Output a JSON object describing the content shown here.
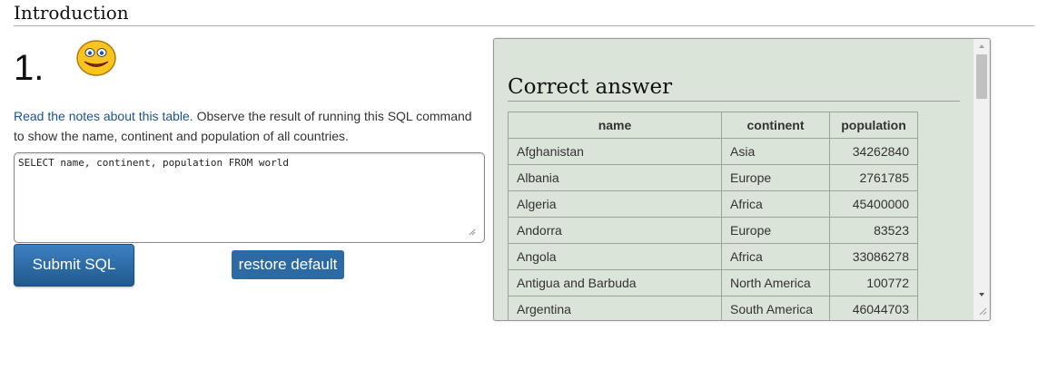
{
  "page": {
    "heading": "Introduction"
  },
  "question": {
    "number": "1.",
    "smiley_icon": "smiley-face-icon",
    "notes_link": "Read the notes about this table.",
    "instruction": " Observe the result of running this SQL command to show the name, continent and population of all countries."
  },
  "editor": {
    "sql": "SELECT name, continent, population FROM world"
  },
  "buttons": {
    "submit": "Submit SQL",
    "restore": "restore default"
  },
  "answer": {
    "title": "Correct answer",
    "columns": [
      "name",
      "continent",
      "population"
    ],
    "rows": [
      [
        "Afghanistan",
        "Asia",
        "34262840"
      ],
      [
        "Albania",
        "Europe",
        "2761785"
      ],
      [
        "Algeria",
        "Africa",
        "45400000"
      ],
      [
        "Andorra",
        "Europe",
        "83523"
      ],
      [
        "Angola",
        "Africa",
        "33086278"
      ],
      [
        "Antigua and Barbuda",
        "North America",
        "100772"
      ],
      [
        "Argentina",
        "South America",
        "46044703"
      ]
    ]
  },
  "colors": {
    "panel": "#dbe4d8",
    "button": "#2b6aa4",
    "link": "#1a5490"
  }
}
